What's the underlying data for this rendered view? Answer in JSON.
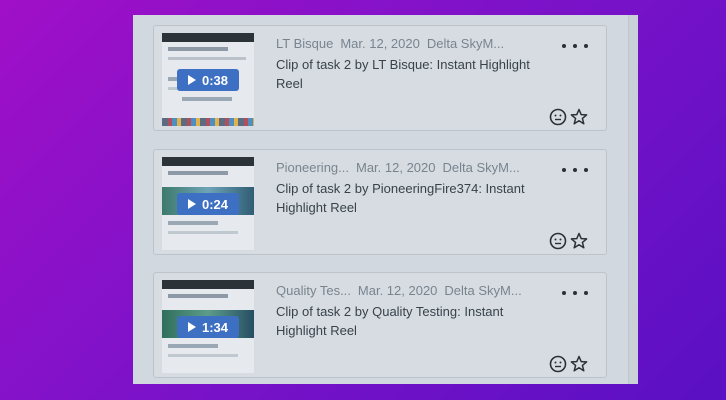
{
  "clips": [
    {
      "uploader": "LT Bisque",
      "date": "Mar. 12, 2020",
      "study": "Delta SkyM...",
      "title": "Clip of task 2 by LT Bisque: Instant Highlight Reel",
      "duration": "0:38"
    },
    {
      "uploader": "Pioneering...",
      "date": "Mar. 12, 2020",
      "study": "Delta SkyM...",
      "title": "Clip of task 2 by PioneeringFire374: Instant Highlight Reel",
      "duration": "0:24"
    },
    {
      "uploader": "Quality Tes...",
      "date": "Mar. 12, 2020",
      "study": "Delta SkyM...",
      "title": "Clip of task 2 by Quality Testing: Instant Highlight Reel",
      "duration": "1:34"
    }
  ],
  "icons": {
    "more": "more-options-icon",
    "reaction": "smiley-face-icon",
    "favorite": "star-icon",
    "play": "play-icon"
  },
  "colors": {
    "background_start": "#a010c8",
    "background_end": "#5a10c4",
    "panel": "#d1d8df",
    "duration_badge": "#3d6fc2"
  }
}
